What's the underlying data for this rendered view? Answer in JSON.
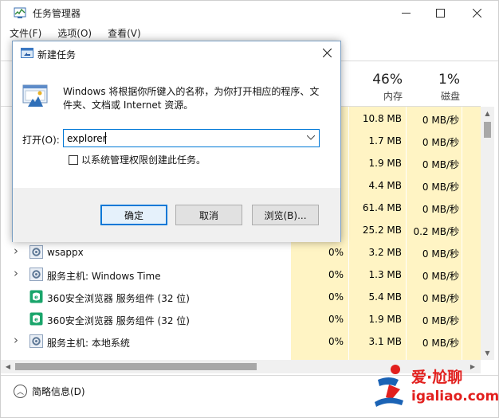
{
  "window": {
    "title": "任务管理器",
    "min_icon": "minimize-icon",
    "max_icon": "maximize-icon",
    "close_icon": "close-icon"
  },
  "menu": [
    "文件(F)",
    "选项(O)",
    "查看(V)"
  ],
  "columns": {
    "memory": {
      "percent": "46%",
      "name": "内存"
    },
    "disk": {
      "percent": "1%",
      "name": "磁盘"
    }
  },
  "rows": [
    {
      "name": "",
      "expand": false,
      "cpu": "",
      "mem": "10.8 MB",
      "disk": "0 MB/秒"
    },
    {
      "name": "",
      "expand": false,
      "cpu": "",
      "mem": "1.7 MB",
      "disk": "0 MB/秒"
    },
    {
      "name": "",
      "expand": false,
      "cpu": "",
      "mem": "1.9 MB",
      "disk": "0 MB/秒"
    },
    {
      "name": "",
      "expand": false,
      "cpu": "",
      "mem": "4.4 MB",
      "disk": "0 MB/秒"
    },
    {
      "name": "",
      "expand": false,
      "cpu": "",
      "mem": "61.4 MB",
      "disk": "0 MB/秒"
    },
    {
      "name": "",
      "expand": false,
      "cpu": "",
      "mem": "25.2 MB",
      "disk": "0.2 MB/秒"
    },
    {
      "name": "wsappx",
      "expand": true,
      "icon": "gear-icon",
      "cpu": "0%",
      "mem": "3.2 MB",
      "disk": "0 MB/秒"
    },
    {
      "name": "服务主机: Windows Time",
      "expand": true,
      "icon": "gear-icon",
      "cpu": "0%",
      "mem": "1.3 MB",
      "disk": "0 MB/秒"
    },
    {
      "name": "360安全浏览器 服务组件 (32 位)",
      "expand": false,
      "icon": "browser-360-icon",
      "cpu": "0%",
      "mem": "5.4 MB",
      "disk": "0 MB/秒"
    },
    {
      "name": "360安全浏览器 服务组件 (32 位)",
      "expand": false,
      "icon": "browser-360-icon",
      "cpu": "0%",
      "mem": "1.9 MB",
      "disk": "0 MB/秒"
    },
    {
      "name": "服务主机: 本地系统",
      "expand": true,
      "icon": "gear-icon",
      "cpu": "0%",
      "mem": "3.1 MB",
      "disk": "0 MB/秒"
    }
  ],
  "footer": {
    "fewer_details": "简略信息(D)"
  },
  "run_dialog": {
    "title": "新建任务",
    "description": "Windows 将根据你所键入的名称，为你打开相应的程序、文件夹、文档或 Internet 资源。",
    "open_label": "打开(O):",
    "input_value": "explorer",
    "admin_checkbox_label": "以系统管理权限创建此任务。",
    "admin_checked": false,
    "ok": "确定",
    "cancel": "取消",
    "browse": "浏览(B)..."
  },
  "watermark": {
    "cn": "爱·尬聊",
    "url": "igaliao.com"
  },
  "colors": {
    "accent": "#0078d7",
    "highlight": "#fff4c4",
    "watermark": "#e2201e"
  }
}
